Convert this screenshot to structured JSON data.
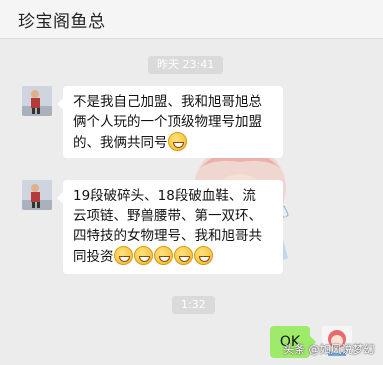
{
  "header": {
    "title": "珍宝阁鱼总"
  },
  "timestamps": {
    "first": "昨天 23:41",
    "second": "1:32"
  },
  "messages": [
    {
      "sender": "contact",
      "text": "不是我自己加盟、我和旭哥旭总俩个人玩的一个顶级物理号加盟的、我俩共同号",
      "lines": [
        "不是我自己加盟、我和旭哥旭总",
        "俩个人玩的一个顶级物理号加盟",
        "的、我俩共同号"
      ],
      "emoji": [
        "grin-emoji"
      ]
    },
    {
      "sender": "contact",
      "text": "19段破碎头、18段破血鞋、流云项链、野兽腰带、第一双环、四特技的女物理号、我和旭哥共同投资",
      "lines": [
        "19段破碎头、18段破血鞋、流",
        "云项链、野兽腰带、第一双环、",
        "四特技的女物理号、我和旭哥共",
        "同投资"
      ],
      "emoji": [
        "grin-emoji",
        "grin-emoji",
        "grin-emoji",
        "grin-emoji",
        "grin-emoji"
      ]
    },
    {
      "sender": "self",
      "text": "OK"
    }
  ],
  "watermark": {
    "text": "头条 @如风说梦幻"
  },
  "colors": {
    "self_bubble": "#9eea6a",
    "background": "#ececec"
  }
}
